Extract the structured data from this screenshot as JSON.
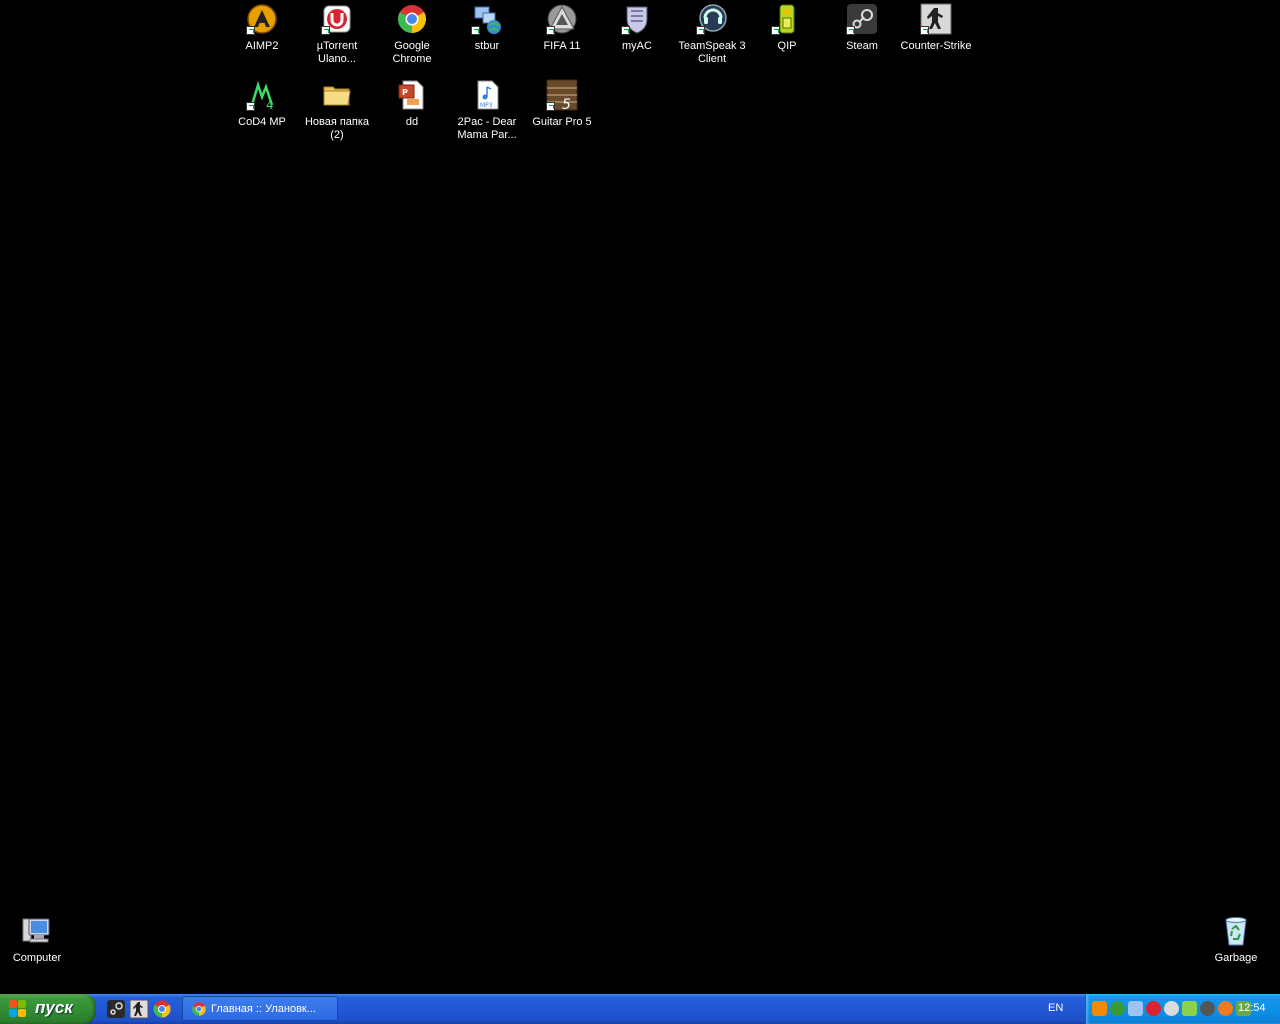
{
  "desktop": {
    "icons": [
      {
        "label": "AIMP2"
      },
      {
        "label": "µTorrent\nUlano..."
      },
      {
        "label": "Google\nChrome"
      },
      {
        "label": "stbur"
      },
      {
        "label": "FIFA 11"
      },
      {
        "label": "myAC"
      },
      {
        "label": "TeamSpeak 3\nClient"
      },
      {
        "label": "QIP"
      },
      {
        "label": "Steam"
      },
      {
        "label": "Counter-Strike"
      },
      {
        "label": "CoD4 MP"
      },
      {
        "label": "Новая папка\n(2)"
      },
      {
        "label": "dd"
      },
      {
        "label": "2Pac - Dear\nMama Par..."
      },
      {
        "label": "Guitar Pro 5"
      },
      {
        "label": "Computer"
      },
      {
        "label": "Garbage"
      }
    ]
  },
  "taskbar": {
    "start_label": "пуск",
    "task_button": "Главная :: Улановк...",
    "language": "EN",
    "clock": "12:54"
  },
  "colors": {
    "desktop_bg": "#000000",
    "taskbar_blue": "#245edb",
    "start_green": "#3c9a3c",
    "tray_blue": "#0f97ec"
  }
}
